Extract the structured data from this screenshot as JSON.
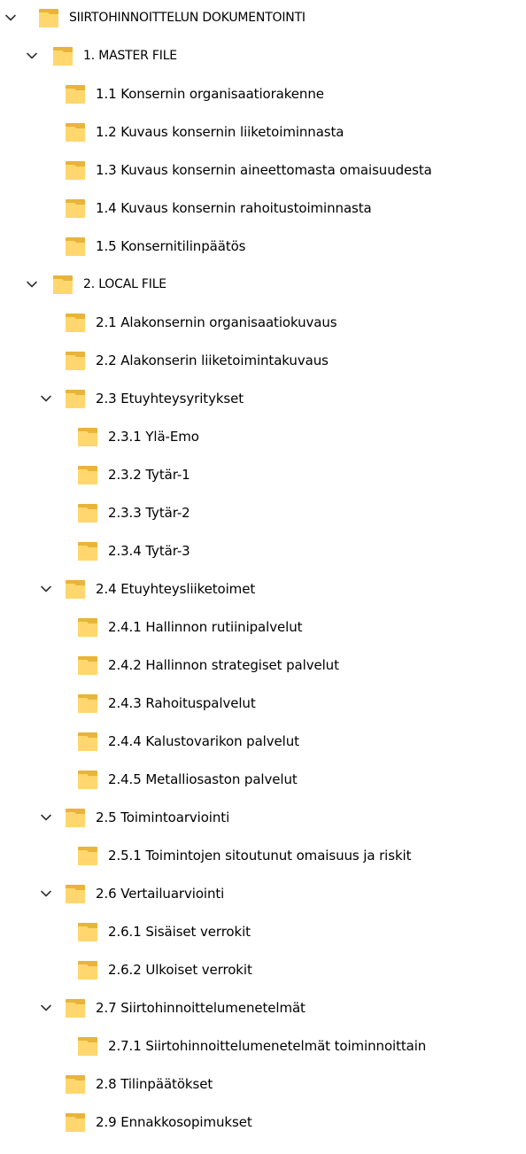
{
  "colors": {
    "folder_front": "#FFD76E",
    "folder_back": "#E8B43A",
    "chevron": "#333333",
    "text": "#000000"
  },
  "tree": [
    {
      "label": "SIIRTOHINNOITTELUN DOKUMENTOINTI",
      "level": 0,
      "expanded": true,
      "upper": true,
      "icon": "folder-icon",
      "toggle_icon": "chevron-down-icon"
    },
    {
      "label": "1. MASTER FILE",
      "level": 1,
      "expanded": true,
      "upper": true,
      "icon": "folder-icon",
      "toggle_icon": "chevron-down-icon"
    },
    {
      "label": "1.1 Konsernin organisaatiorakenne",
      "level": 2,
      "expanded": null,
      "icon": "folder-icon"
    },
    {
      "label": "1.2 Kuvaus konsernin liiketoiminnasta",
      "level": 2,
      "expanded": null,
      "icon": "folder-icon"
    },
    {
      "label": "1.3 Kuvaus konsernin aineettomasta omaisuudesta",
      "level": 2,
      "expanded": null,
      "icon": "folder-icon"
    },
    {
      "label": "1.4 Kuvaus konsernin rahoitustoiminnasta",
      "level": 2,
      "expanded": null,
      "icon": "folder-icon"
    },
    {
      "label": "1.5 Konsernitilinpäätös",
      "level": 2,
      "expanded": null,
      "icon": "folder-icon"
    },
    {
      "label": "2. LOCAL FILE",
      "level": 1,
      "expanded": true,
      "upper": true,
      "icon": "folder-icon",
      "toggle_icon": "chevron-down-icon"
    },
    {
      "label": "2.1 Alakonsernin organisaatiokuvaus",
      "level": 2,
      "expanded": null,
      "icon": "folder-icon"
    },
    {
      "label": "2.2 Alakonserin liiketoimintakuvaus",
      "level": 2,
      "expanded": null,
      "icon": "folder-icon"
    },
    {
      "label": "2.3 Etuyhteysyritykset",
      "level": 2,
      "expanded": true,
      "icon": "folder-icon",
      "toggle_icon": "chevron-down-icon"
    },
    {
      "label": "2.3.1 Ylä-Emo",
      "level": 3,
      "expanded": null,
      "icon": "folder-icon"
    },
    {
      "label": "2.3.2 Tytär-1",
      "level": 3,
      "expanded": null,
      "icon": "folder-icon"
    },
    {
      "label": "2.3.3 Tytär-2",
      "level": 3,
      "expanded": null,
      "icon": "folder-icon"
    },
    {
      "label": "2.3.4 Tytär-3",
      "level": 3,
      "expanded": null,
      "icon": "folder-icon"
    },
    {
      "label": "2.4 Etuyhteysliiketoimet",
      "level": 2,
      "expanded": true,
      "icon": "folder-icon",
      "toggle_icon": "chevron-down-icon"
    },
    {
      "label": "2.4.1 Hallinnon rutiinipalvelut",
      "level": 3,
      "expanded": null,
      "icon": "folder-icon"
    },
    {
      "label": "2.4.2 Hallinnon strategiset palvelut",
      "level": 3,
      "expanded": null,
      "icon": "folder-icon"
    },
    {
      "label": "2.4.3 Rahoituspalvelut",
      "level": 3,
      "expanded": null,
      "icon": "folder-icon"
    },
    {
      "label": "2.4.4 Kalustovarikon palvelut",
      "level": 3,
      "expanded": null,
      "icon": "folder-icon"
    },
    {
      "label": "2.4.5 Metalliosaston palvelut",
      "level": 3,
      "expanded": null,
      "icon": "folder-icon"
    },
    {
      "label": "2.5 Toimintoarviointi",
      "level": 2,
      "expanded": true,
      "icon": "folder-icon",
      "toggle_icon": "chevron-down-icon"
    },
    {
      "label": "2.5.1 Toimintojen sitoutunut omaisuus ja riskit",
      "level": 3,
      "expanded": null,
      "icon": "folder-icon"
    },
    {
      "label": "2.6 Vertailuarviointi",
      "level": 2,
      "expanded": true,
      "icon": "folder-icon",
      "toggle_icon": "chevron-down-icon"
    },
    {
      "label": "2.6.1 Sisäiset verrokit",
      "level": 3,
      "expanded": null,
      "icon": "folder-icon"
    },
    {
      "label": "2.6.2 Ulkoiset verrokit",
      "level": 3,
      "expanded": null,
      "icon": "folder-icon"
    },
    {
      "label": "2.7 Siirtohinnoittelumenetelmät",
      "level": 2,
      "expanded": true,
      "icon": "folder-icon",
      "toggle_icon": "chevron-down-icon"
    },
    {
      "label": "2.7.1 Siirtohinnoittelumenetelmät toiminnoittain",
      "level": 3,
      "expanded": null,
      "icon": "folder-icon"
    },
    {
      "label": "2.8 Tilinpäätökset",
      "level": 2,
      "expanded": null,
      "icon": "folder-icon"
    },
    {
      "label": "2.9 Ennakkosopimukset",
      "level": 2,
      "expanded": null,
      "icon": "folder-icon"
    }
  ]
}
